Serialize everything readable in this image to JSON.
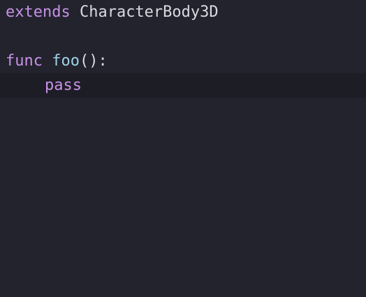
{
  "code": {
    "line1": {
      "keyword": "extends",
      "space": " ",
      "type": "CharacterBody3D"
    },
    "line2": {
      "text": ""
    },
    "line3": {
      "keyword": "func",
      "space": " ",
      "function_name": "foo",
      "punctuation": "():"
    },
    "line4": {
      "keyword": "pass"
    }
  },
  "colors": {
    "background": "#23232e",
    "current_line": "#1d1d26",
    "keyword": "#c792e6",
    "function_name": "#9fd3e6",
    "text": "#d9d9e2"
  }
}
